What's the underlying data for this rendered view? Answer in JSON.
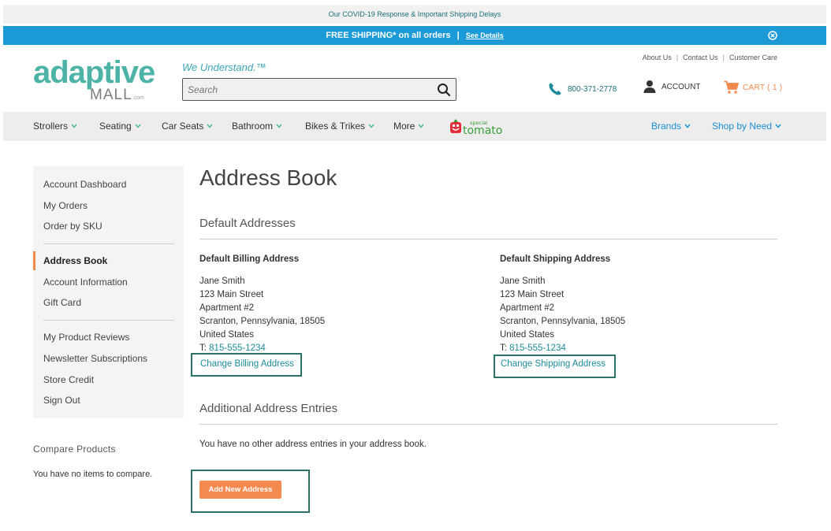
{
  "announcement": {
    "text": "Our COVID-19 Response & Important Shipping Delays"
  },
  "shipping_bar": {
    "text": "FREE SHIPPING* on all orders",
    "separator": "|",
    "details_link": "See Details",
    "close_icon": "close-circle-icon"
  },
  "logo": {
    "word": "adaptive",
    "sub": "MALL",
    "suffix": ".com"
  },
  "tagline": "We Understand.™",
  "search": {
    "placeholder": "Search",
    "icon": "search-icon"
  },
  "top_links": {
    "about": "About Us",
    "contact": "Contact Us",
    "care": "Customer Care",
    "separator": "|"
  },
  "header": {
    "phone": {
      "icon": "phone-icon",
      "number": "800-371-2778",
      "color": "#1d8b9a"
    },
    "account": {
      "icon": "user-icon",
      "label": "ACCOUNT"
    },
    "cart": {
      "icon": "cart-icon",
      "label": "CART ( 1 )",
      "color": "#f08a4b"
    }
  },
  "nav": {
    "items": [
      {
        "label": "Strollers"
      },
      {
        "label": "Seating"
      },
      {
        "label": "Car Seats"
      },
      {
        "label": "Bathroom"
      },
      {
        "label": "Bikes & Trikes"
      },
      {
        "label": "More"
      }
    ],
    "special_tomato": {
      "small": "special",
      "big": "tomato"
    },
    "right_items": [
      {
        "label": "Brands"
      },
      {
        "label": "Shop by Need"
      }
    ]
  },
  "sidebar": {
    "group1": [
      "Account Dashboard",
      "My Orders",
      "Order by SKU"
    ],
    "active": "Address Book",
    "group2": [
      "Account Information",
      "Gift Card"
    ],
    "group3": [
      "My Product Reviews",
      "Newsletter Subscriptions",
      "Store Credit",
      "Sign Out"
    ],
    "accent_color": "#f08a4b"
  },
  "compare": {
    "title": "Compare Products",
    "empty": "You have no items to compare."
  },
  "main": {
    "title": "Address Book",
    "default_section": "Default Addresses",
    "billing": {
      "heading": "Default Billing Address",
      "lines": [
        "Jane Smith",
        "123 Main Street",
        "Apartment #2",
        "Scranton, Pennsylvania, 18505",
        "United States"
      ],
      "tel_prefix": "T:",
      "tel": "815-555-1234",
      "change_link": "Change Billing Address"
    },
    "shipping": {
      "heading": "Default Shipping Address",
      "lines": [
        "Jane Smith",
        "123 Main Street",
        "Apartment #2",
        "Scranton, Pennsylvania, 18505",
        "United States"
      ],
      "tel_prefix": "T:",
      "tel": "815-555-1234",
      "change_link": "Change Shipping Address"
    },
    "additional_section": "Additional Address Entries",
    "no_entries": "You have no other address entries in your address book.",
    "add_button": "Add New Address",
    "highlight_color": "#2e7168",
    "button_color": "#f58a51"
  }
}
